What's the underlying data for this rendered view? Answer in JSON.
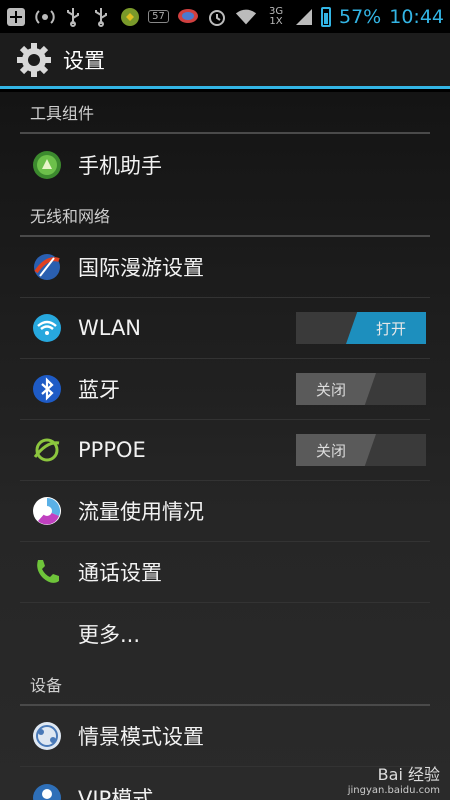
{
  "status_bar": {
    "battery_percent": "57%",
    "time": "10:44",
    "network": "3G 1X",
    "notification_badge": "57",
    "icons": [
      "add-icon",
      "usb-debug-icon",
      "usb-icon",
      "usb-icon",
      "app-icon",
      "sim-icon",
      "chat-icon",
      "alarm-icon",
      "wifi-icon",
      "signal-icon",
      "battery-icon"
    ]
  },
  "action_bar": {
    "title": "设置",
    "icon": "gear-icon",
    "accent": "#33b5e5"
  },
  "sections": {
    "tools": "工具组件",
    "wireless": "无线和网络",
    "device": "设备"
  },
  "items": {
    "assistant": {
      "label": "手机助手",
      "icon": "phone-assistant-icon"
    },
    "roaming": {
      "label": "国际漫游设置",
      "icon": "roaming-icon"
    },
    "wlan": {
      "label": "WLAN",
      "icon": "wifi-icon",
      "toggle": "打开",
      "state": "on"
    },
    "bluetooth": {
      "label": "蓝牙",
      "icon": "bluetooth-icon",
      "toggle": "关闭",
      "state": "off"
    },
    "pppoe": {
      "label": "PPPOE",
      "icon": "pppoe-icon",
      "toggle": "关闭",
      "state": "off"
    },
    "data_usage": {
      "label": "流量使用情况",
      "icon": "data-usage-icon"
    },
    "call": {
      "label": "通话设置",
      "icon": "phone-icon"
    },
    "more": {
      "label": "更多..."
    },
    "profiles": {
      "label": "情景模式设置",
      "icon": "profile-icon"
    },
    "vip": {
      "label": "VIP模式",
      "icon": "vip-icon"
    }
  },
  "watermark": {
    "brand": "Bai 经验",
    "url": "jingyan.baidu.com"
  },
  "colors": {
    "accent": "#33b5e5",
    "toggle_on": "#1d8fbe",
    "toggle_off": "#5a5a5a"
  }
}
